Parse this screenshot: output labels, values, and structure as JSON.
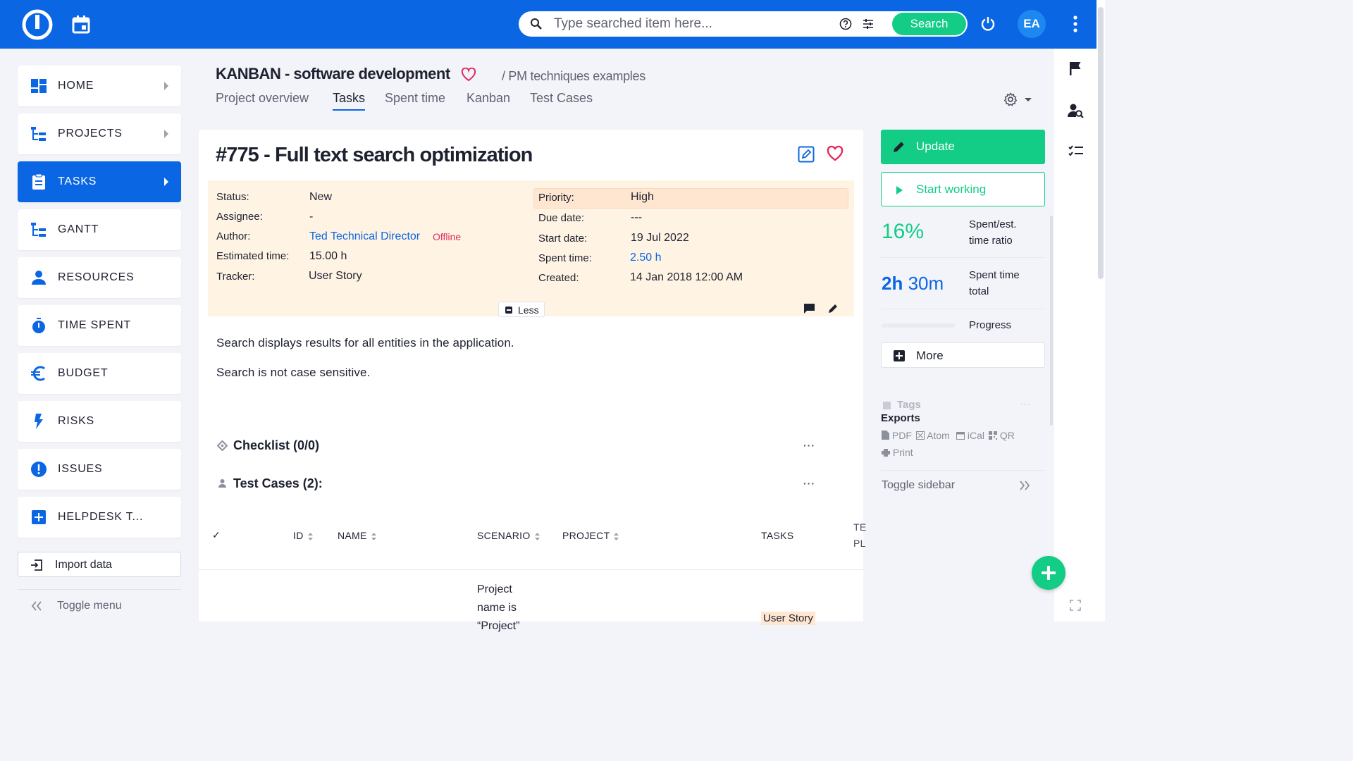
{
  "topbar": {
    "search_placeholder": "Type searched item here...",
    "search_button": "Search",
    "avatar_initials": "EA"
  },
  "menu": {
    "items": [
      {
        "label": "HOME",
        "icon": "dashboard-icon"
      },
      {
        "label": "PROJECTS",
        "icon": "project-tree-icon"
      },
      {
        "label": "TASKS",
        "icon": "clipboard-icon",
        "active": true
      },
      {
        "label": "GANTT",
        "icon": "gantt-icon"
      },
      {
        "label": "RESOURCES",
        "icon": "person-icon"
      },
      {
        "label": "TIME SPENT",
        "icon": "stopwatch-icon"
      },
      {
        "label": "BUDGET",
        "icon": "euro-icon"
      },
      {
        "label": "RISKS",
        "icon": "lightning-icon"
      },
      {
        "label": "ISSUES",
        "icon": "alert-icon"
      },
      {
        "label": "HELPDESK T...",
        "icon": "plus-box-icon"
      }
    ],
    "import_label": "Import data",
    "toggle_label": "Toggle menu"
  },
  "header": {
    "project_title": "KANBAN - software development",
    "breadcrumb": "/ PM techniques examples",
    "tabs": [
      "Project overview",
      "Tasks",
      "Spent time",
      "Kanban",
      "Test Cases"
    ],
    "active_tab": "Tasks"
  },
  "issue": {
    "title": "#775 - Full text search optimization",
    "attributes_left": [
      {
        "label": "Status:",
        "value": "New"
      },
      {
        "label": "Assignee:",
        "value": "-"
      },
      {
        "label": "Author:",
        "value": "Ted Technical Director",
        "status": "Offline"
      },
      {
        "label": "Estimated time:",
        "value": "15.00 h"
      },
      {
        "label": "Tracker:",
        "value": "User Story"
      }
    ],
    "attributes_right": [
      {
        "label": "Priority:",
        "value": "High"
      },
      {
        "label": "Due date:",
        "value": "---"
      },
      {
        "label": "Start date:",
        "value": "19 Jul 2022"
      },
      {
        "label": "Spent time:",
        "value": "2.50 h"
      },
      {
        "label": "Created:",
        "value": "14 Jan 2018 12:00 AM"
      }
    ],
    "less_label": "Less",
    "description": [
      "Search displays results for all entities in the application.",
      "Search is not case sensitive."
    ],
    "checklist_title": "Checklist (0/0)",
    "testcases_title": "Test Cases (2):",
    "more_dots": "···",
    "table": {
      "check": "✓",
      "columns": [
        "ID",
        "NAME",
        "SCENARIO",
        "PROJECT",
        "TASKS",
        "TE",
        "PL"
      ],
      "row": {
        "scenario": "Project name is “Project”",
        "tasks": "User Story"
      }
    }
  },
  "sidebar": {
    "update_label": "Update",
    "start_label": "Start working",
    "ratio_value": "16%",
    "ratio_label": "Spent/est. time ratio",
    "spent_value_h": "2h",
    "spent_value_m": "30m",
    "spent_label": "Spent time total",
    "progress_label": "Progress",
    "progress_value": 0,
    "more_label": "More",
    "tags_label": "Tags",
    "tags_dots": "···",
    "exports_label": "Exports",
    "exports": [
      "PDF",
      "Atom",
      "iCal",
      "QR",
      "Print"
    ],
    "toggle_sidebar": "Toggle sidebar"
  },
  "colors": {
    "brand_blue": "#0b66e4",
    "accent_green": "#13cc86",
    "attr_background": "#fff4e3",
    "priority_highlight": "#ffe6d0",
    "offline_red": "#e3285c"
  }
}
